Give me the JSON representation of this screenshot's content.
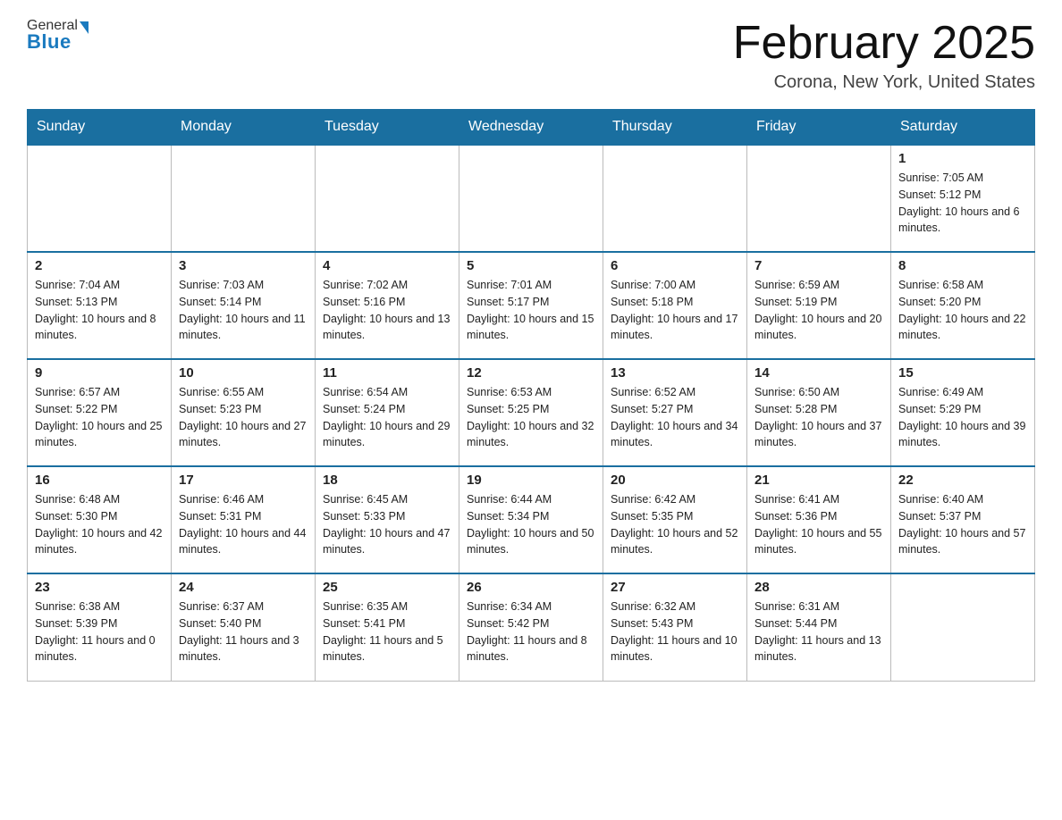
{
  "header": {
    "logo_general": "General",
    "logo_blue": "Blue",
    "month_title": "February 2025",
    "location": "Corona, New York, United States"
  },
  "weekdays": [
    "Sunday",
    "Monday",
    "Tuesday",
    "Wednesday",
    "Thursday",
    "Friday",
    "Saturday"
  ],
  "weeks": [
    [
      {
        "day": "",
        "sunrise": "",
        "sunset": "",
        "daylight": ""
      },
      {
        "day": "",
        "sunrise": "",
        "sunset": "",
        "daylight": ""
      },
      {
        "day": "",
        "sunrise": "",
        "sunset": "",
        "daylight": ""
      },
      {
        "day": "",
        "sunrise": "",
        "sunset": "",
        "daylight": ""
      },
      {
        "day": "",
        "sunrise": "",
        "sunset": "",
        "daylight": ""
      },
      {
        "day": "",
        "sunrise": "",
        "sunset": "",
        "daylight": ""
      },
      {
        "day": "1",
        "sunrise": "Sunrise: 7:05 AM",
        "sunset": "Sunset: 5:12 PM",
        "daylight": "Daylight: 10 hours and 6 minutes."
      }
    ],
    [
      {
        "day": "2",
        "sunrise": "Sunrise: 7:04 AM",
        "sunset": "Sunset: 5:13 PM",
        "daylight": "Daylight: 10 hours and 8 minutes."
      },
      {
        "day": "3",
        "sunrise": "Sunrise: 7:03 AM",
        "sunset": "Sunset: 5:14 PM",
        "daylight": "Daylight: 10 hours and 11 minutes."
      },
      {
        "day": "4",
        "sunrise": "Sunrise: 7:02 AM",
        "sunset": "Sunset: 5:16 PM",
        "daylight": "Daylight: 10 hours and 13 minutes."
      },
      {
        "day": "5",
        "sunrise": "Sunrise: 7:01 AM",
        "sunset": "Sunset: 5:17 PM",
        "daylight": "Daylight: 10 hours and 15 minutes."
      },
      {
        "day": "6",
        "sunrise": "Sunrise: 7:00 AM",
        "sunset": "Sunset: 5:18 PM",
        "daylight": "Daylight: 10 hours and 17 minutes."
      },
      {
        "day": "7",
        "sunrise": "Sunrise: 6:59 AM",
        "sunset": "Sunset: 5:19 PM",
        "daylight": "Daylight: 10 hours and 20 minutes."
      },
      {
        "day": "8",
        "sunrise": "Sunrise: 6:58 AM",
        "sunset": "Sunset: 5:20 PM",
        "daylight": "Daylight: 10 hours and 22 minutes."
      }
    ],
    [
      {
        "day": "9",
        "sunrise": "Sunrise: 6:57 AM",
        "sunset": "Sunset: 5:22 PM",
        "daylight": "Daylight: 10 hours and 25 minutes."
      },
      {
        "day": "10",
        "sunrise": "Sunrise: 6:55 AM",
        "sunset": "Sunset: 5:23 PM",
        "daylight": "Daylight: 10 hours and 27 minutes."
      },
      {
        "day": "11",
        "sunrise": "Sunrise: 6:54 AM",
        "sunset": "Sunset: 5:24 PM",
        "daylight": "Daylight: 10 hours and 29 minutes."
      },
      {
        "day": "12",
        "sunrise": "Sunrise: 6:53 AM",
        "sunset": "Sunset: 5:25 PM",
        "daylight": "Daylight: 10 hours and 32 minutes."
      },
      {
        "day": "13",
        "sunrise": "Sunrise: 6:52 AM",
        "sunset": "Sunset: 5:27 PM",
        "daylight": "Daylight: 10 hours and 34 minutes."
      },
      {
        "day": "14",
        "sunrise": "Sunrise: 6:50 AM",
        "sunset": "Sunset: 5:28 PM",
        "daylight": "Daylight: 10 hours and 37 minutes."
      },
      {
        "day": "15",
        "sunrise": "Sunrise: 6:49 AM",
        "sunset": "Sunset: 5:29 PM",
        "daylight": "Daylight: 10 hours and 39 minutes."
      }
    ],
    [
      {
        "day": "16",
        "sunrise": "Sunrise: 6:48 AM",
        "sunset": "Sunset: 5:30 PM",
        "daylight": "Daylight: 10 hours and 42 minutes."
      },
      {
        "day": "17",
        "sunrise": "Sunrise: 6:46 AM",
        "sunset": "Sunset: 5:31 PM",
        "daylight": "Daylight: 10 hours and 44 minutes."
      },
      {
        "day": "18",
        "sunrise": "Sunrise: 6:45 AM",
        "sunset": "Sunset: 5:33 PM",
        "daylight": "Daylight: 10 hours and 47 minutes."
      },
      {
        "day": "19",
        "sunrise": "Sunrise: 6:44 AM",
        "sunset": "Sunset: 5:34 PM",
        "daylight": "Daylight: 10 hours and 50 minutes."
      },
      {
        "day": "20",
        "sunrise": "Sunrise: 6:42 AM",
        "sunset": "Sunset: 5:35 PM",
        "daylight": "Daylight: 10 hours and 52 minutes."
      },
      {
        "day": "21",
        "sunrise": "Sunrise: 6:41 AM",
        "sunset": "Sunset: 5:36 PM",
        "daylight": "Daylight: 10 hours and 55 minutes."
      },
      {
        "day": "22",
        "sunrise": "Sunrise: 6:40 AM",
        "sunset": "Sunset: 5:37 PM",
        "daylight": "Daylight: 10 hours and 57 minutes."
      }
    ],
    [
      {
        "day": "23",
        "sunrise": "Sunrise: 6:38 AM",
        "sunset": "Sunset: 5:39 PM",
        "daylight": "Daylight: 11 hours and 0 minutes."
      },
      {
        "day": "24",
        "sunrise": "Sunrise: 6:37 AM",
        "sunset": "Sunset: 5:40 PM",
        "daylight": "Daylight: 11 hours and 3 minutes."
      },
      {
        "day": "25",
        "sunrise": "Sunrise: 6:35 AM",
        "sunset": "Sunset: 5:41 PM",
        "daylight": "Daylight: 11 hours and 5 minutes."
      },
      {
        "day": "26",
        "sunrise": "Sunrise: 6:34 AM",
        "sunset": "Sunset: 5:42 PM",
        "daylight": "Daylight: 11 hours and 8 minutes."
      },
      {
        "day": "27",
        "sunrise": "Sunrise: 6:32 AM",
        "sunset": "Sunset: 5:43 PM",
        "daylight": "Daylight: 11 hours and 10 minutes."
      },
      {
        "day": "28",
        "sunrise": "Sunrise: 6:31 AM",
        "sunset": "Sunset: 5:44 PM",
        "daylight": "Daylight: 11 hours and 13 minutes."
      },
      {
        "day": "",
        "sunrise": "",
        "sunset": "",
        "daylight": ""
      }
    ]
  ]
}
